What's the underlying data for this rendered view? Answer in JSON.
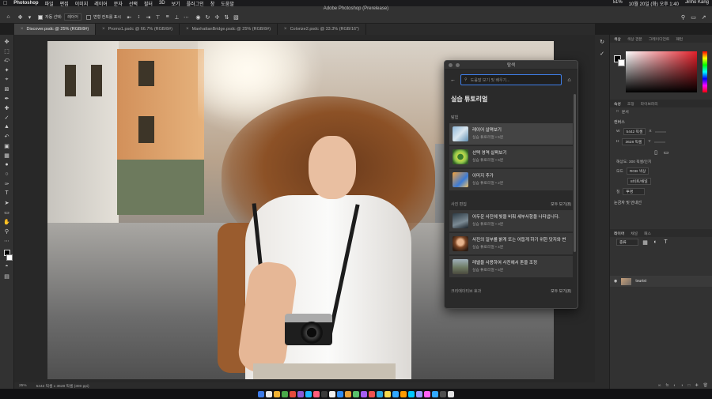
{
  "menubar": {
    "app": "Photoshop",
    "menus": [
      "파일",
      "편집",
      "이미지",
      "레이어",
      "문자",
      "선택",
      "필터",
      "3D",
      "보기",
      "플러그인",
      "창",
      "도움말"
    ],
    "right": [
      "51%",
      "10월 20일 (화) 오후 1:40",
      "Jinho Kang"
    ]
  },
  "optionsbar": {
    "title": "Adobe Photoshop (Prerelease)",
    "auto_select_label": "자동 선택:",
    "auto_select_target": "레이어",
    "transform_controls": "변형 컨트롤 표시"
  },
  "tabs": [
    {
      "label": "Discover.psdc @ 25% (RGB/8#)",
      "active": true
    },
    {
      "label": "Promo1.psdc @ 66.7% (RGB/8#)",
      "active": false
    },
    {
      "label": "ManhattanBridge.psdc @ 25% (RGB/8#)",
      "active": false
    },
    {
      "label": "Colorize2.psdc @ 33.3% (RGB/16\")",
      "active": false
    }
  ],
  "learn_panel": {
    "title": "탐색",
    "search_placeholder": "도움말 보기 및 배우기...",
    "heading": "실습 튜토리얼",
    "section_basic": "탐험",
    "section_photo": "사진 편집",
    "section_creative": "크리에이티브 효과",
    "see_all": "모두 보기(8)",
    "basic_items": [
      {
        "name": "레이어 살펴보기",
        "meta": "실습 튜토리얼 • 5분"
      },
      {
        "name": "선택 영역 살펴보기",
        "meta": "실습 튜토리얼 • 6분"
      },
      {
        "name": "이미지 추가",
        "meta": "실습 튜토리얼 • 2분"
      }
    ],
    "photo_items": [
      {
        "name": "어두운 사진에 빛을 비춰 세부사항을 나타냅니다.",
        "meta": "실습 튜토리얼 • 3분"
      },
      {
        "name": "사진의 일부를 밝게 또는 어둡게 하기 위한 닷지와 번",
        "meta": "실습 튜토리얼 • 4분"
      },
      {
        "name": "레벨을 사용하여 사진에서 톤을 조정",
        "meta": "실습 튜토리얼 • 5분"
      }
    ]
  },
  "right_panel": {
    "color_tabs": [
      "색상",
      "색상 견본",
      "그레이디언트",
      "패턴"
    ],
    "prop_tabs": [
      "속성",
      "조정",
      "라이브러리"
    ],
    "doc_label": "문서",
    "canvas_label": "캔버스",
    "w_label": "W",
    "w_value": "5442 픽셀",
    "h_label": "H",
    "h_value": "3628 픽셀",
    "x_label": "X",
    "y_label": "Y",
    "resolution": "해상도: 300 픽셀/인치",
    "mode_label": "모드",
    "mode_value": "RGB 색상",
    "depth_value": "8비트/채널",
    "fill_label": "칠",
    "fill_value": "투명",
    "guides_label": "눈금자 및 안내선",
    "layer_tabs": [
      "레이어",
      "채널",
      "패스"
    ],
    "kind_label": "종류",
    "layer_name": "tourist"
  },
  "status": {
    "zoom": "25%",
    "doc_info": "5442 픽셀 x 3628 픽셀 (300 ppi)"
  },
  "dock_colors": [
    "#3d7be8",
    "#e8e8e8",
    "#f2b233",
    "#49a84a",
    "#e54b3c",
    "#8c5bd6",
    "#1fb6ff",
    "#ff5d7a",
    "#3a3a3a",
    "#f0f0f0",
    "#2f8cf4",
    "#e9a038",
    "#5ac16b",
    "#a55ef2",
    "#ef5350",
    "#2ba8e0",
    "#f7d94c",
    "#31a8ff",
    "#ff9a00",
    "#00c8ff",
    "#9999ff",
    "#ff61f6",
    "#31a8ff",
    "#4f4f4f",
    "#e2e2e2"
  ]
}
